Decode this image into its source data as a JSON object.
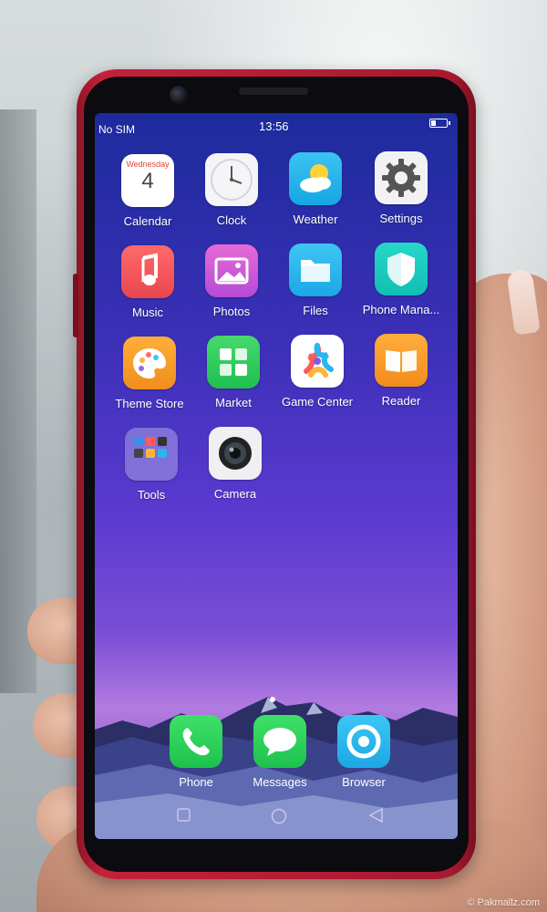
{
  "status_bar": {
    "carrier": "No SIM",
    "time": "13:56"
  },
  "apps": [
    {
      "label": "Calendar",
      "icon": "calendar-icon",
      "day_name": "Wednesday",
      "day_number": "4"
    },
    {
      "label": "Clock",
      "icon": "clock-icon"
    },
    {
      "label": "Weather",
      "icon": "weather-icon"
    },
    {
      "label": "Settings",
      "icon": "gear-icon"
    },
    {
      "label": "Music",
      "icon": "music-note-icon"
    },
    {
      "label": "Photos",
      "icon": "photo-icon"
    },
    {
      "label": "Files",
      "icon": "folder-icon"
    },
    {
      "label": "Phone Mana...",
      "icon": "shield-icon"
    },
    {
      "label": "Theme Store",
      "icon": "palette-icon"
    },
    {
      "label": "Market",
      "icon": "app-grid-icon"
    },
    {
      "label": "Game Center",
      "icon": "star-icon"
    },
    {
      "label": "Reader",
      "icon": "book-icon"
    },
    {
      "label": "Tools",
      "icon": "folder-tools-icon"
    },
    {
      "label": "Camera",
      "icon": "camera-icon"
    }
  ],
  "dock": [
    {
      "label": "Phone",
      "icon": "phone-icon"
    },
    {
      "label": "Messages",
      "icon": "message-bubble-icon"
    },
    {
      "label": "Browser",
      "icon": "browser-icon"
    }
  ],
  "watermark": "© Pakmallz.com",
  "colors": {
    "phone_body": "#c4213a",
    "wallpaper_top": "#1c2b9c",
    "wallpaper_mid": "#5a3ad0"
  }
}
